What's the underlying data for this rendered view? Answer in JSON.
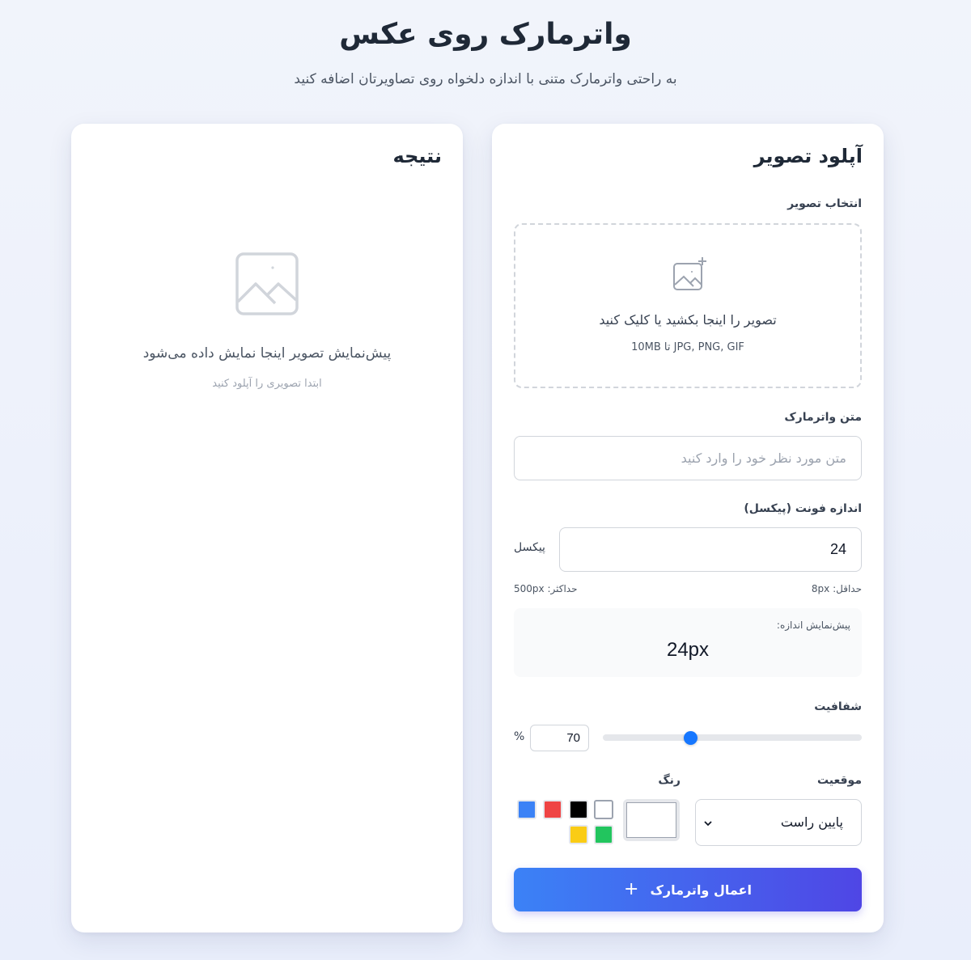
{
  "header": {
    "title": "واترمارک روی عکس",
    "subtitle": "به راحتی واترمارک متنی با اندازه دلخواه روی تصاویرتان اضافه کنید"
  },
  "result": {
    "title": "نتیجه",
    "placeholder_text": "پیش‌نمایش تصویر اینجا نمایش داده می‌شود",
    "placeholder_sub": "ابتدا تصویری را آپلود کنید",
    "placeholder_icon": "image-icon"
  },
  "upload": {
    "title": "آپلود تصویر",
    "select_label": "انتخاب تصویر",
    "dropzone_text": "تصویر را اینجا بکشید یا کلیک کنید",
    "dropzone_sub": "JPG, PNG, GIF تا 10MB",
    "dropzone_icon": "image-plus-icon",
    "watermark_label": "متن واترمارک",
    "watermark_placeholder": "متن مورد نظر خود را وارد کنید",
    "font_size_label": "اندازه فونت (پیکسل)",
    "font_size_value": "24",
    "font_size_unit": "پیکسل",
    "min_text": "حداقل: 8px",
    "max_text": "حداکثر: 500px",
    "preview_label": "پیش‌نمایش اندازه:",
    "preview_value": "24px",
    "opacity_label": "شفافیت",
    "opacity_value": "70",
    "opacity_fraction": 0.34,
    "percent_sign": "%",
    "position_label": "موقعیت",
    "position_value": "پایین راست",
    "color_label": "رنگ",
    "selected_color": "#ffffff",
    "swatches": [
      "#ffffff",
      "#000000",
      "#ef4444",
      "#3b82f6",
      "#22c55e",
      "#facc15"
    ],
    "apply_label": "اعمال واترمارک",
    "apply_icon": "plus-icon"
  },
  "colors": {
    "accent": "#1677ff",
    "button_gradient_start": "#3b82f6",
    "button_gradient_end": "#4f46e5"
  }
}
